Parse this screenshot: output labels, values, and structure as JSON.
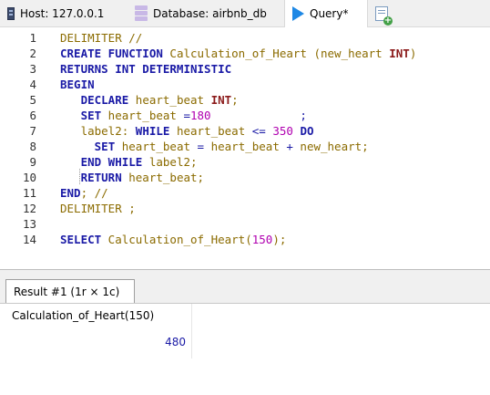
{
  "tabs": {
    "host": "Host: 127.0.0.1",
    "database": "Database: airbnb_db",
    "query": "Query*"
  },
  "editor": {
    "line_numbers": [
      "1",
      "2",
      "3",
      "4",
      "5",
      "6",
      "7",
      "8",
      "9",
      "10",
      "11",
      "12",
      "13",
      "14"
    ],
    "lines": [
      [
        {
          "t": "DELIMITER //",
          "c": "pl"
        }
      ],
      [
        {
          "t": "CREATE FUNCTION",
          "c": "kw"
        },
        {
          "t": " Calculation_of_Heart (new_heart ",
          "c": "id"
        },
        {
          "t": "INT",
          "c": "ty"
        },
        {
          "t": ")",
          "c": "id"
        }
      ],
      [
        {
          "t": "RETURNS INT DETERMINISTIC",
          "c": "kw"
        }
      ],
      [
        {
          "t": "BEGIN",
          "c": "kw"
        }
      ],
      [
        {
          "t": "   ",
          "c": "id"
        },
        {
          "t": "DECLARE",
          "c": "kw"
        },
        {
          "t": " heart_beat ",
          "c": "id"
        },
        {
          "t": "INT",
          "c": "ty"
        },
        {
          "t": ";",
          "c": "id"
        }
      ],
      [
        {
          "t": "   ",
          "c": "id"
        },
        {
          "t": "SET",
          "c": "kw"
        },
        {
          "t": " heart_beat ",
          "c": "id"
        },
        {
          "t": "=",
          "c": "op"
        },
        {
          "t": "180",
          "c": "num"
        },
        {
          "t": "             ;",
          "c": "op"
        }
      ],
      [
        {
          "t": "   label2: ",
          "c": "id"
        },
        {
          "t": "WHILE",
          "c": "kw"
        },
        {
          "t": " heart_beat ",
          "c": "id"
        },
        {
          "t": "<=",
          "c": "op"
        },
        {
          "t": " ",
          "c": "id"
        },
        {
          "t": "350",
          "c": "num"
        },
        {
          "t": " ",
          "c": "id"
        },
        {
          "t": "DO",
          "c": "kw"
        }
      ],
      [
        {
          "t": "     ",
          "c": "id"
        },
        {
          "t": "SET",
          "c": "kw"
        },
        {
          "t": " heart_beat ",
          "c": "id"
        },
        {
          "t": "=",
          "c": "op"
        },
        {
          "t": " heart_beat ",
          "c": "id"
        },
        {
          "t": "+",
          "c": "op"
        },
        {
          "t": " new_heart;",
          "c": "id"
        }
      ],
      [
        {
          "t": "   ",
          "c": "id"
        },
        {
          "t": "END WHILE",
          "c": "kw"
        },
        {
          "t": " label2;",
          "c": "id"
        }
      ],
      [
        {
          "t": "   ",
          "c": "id"
        },
        {
          "t": "RETURN",
          "c": "kw"
        },
        {
          "t": " heart_beat;",
          "c": "id"
        }
      ],
      [
        {
          "t": "END",
          "c": "kw"
        },
        {
          "t": "; //",
          "c": "id"
        }
      ],
      [
        {
          "t": "DELIMITER ;",
          "c": "pl"
        }
      ],
      [],
      [
        {
          "t": "SELECT",
          "c": "kw"
        },
        {
          "t": " Calculation_of_Heart(",
          "c": "id"
        },
        {
          "t": "150",
          "c": "num"
        },
        {
          "t": ");",
          "c": "id"
        }
      ]
    ]
  },
  "result": {
    "tab_label": "Result #1 (1r × 1c)",
    "column_header": "Calculation_of_Heart(150)",
    "value": "480"
  }
}
